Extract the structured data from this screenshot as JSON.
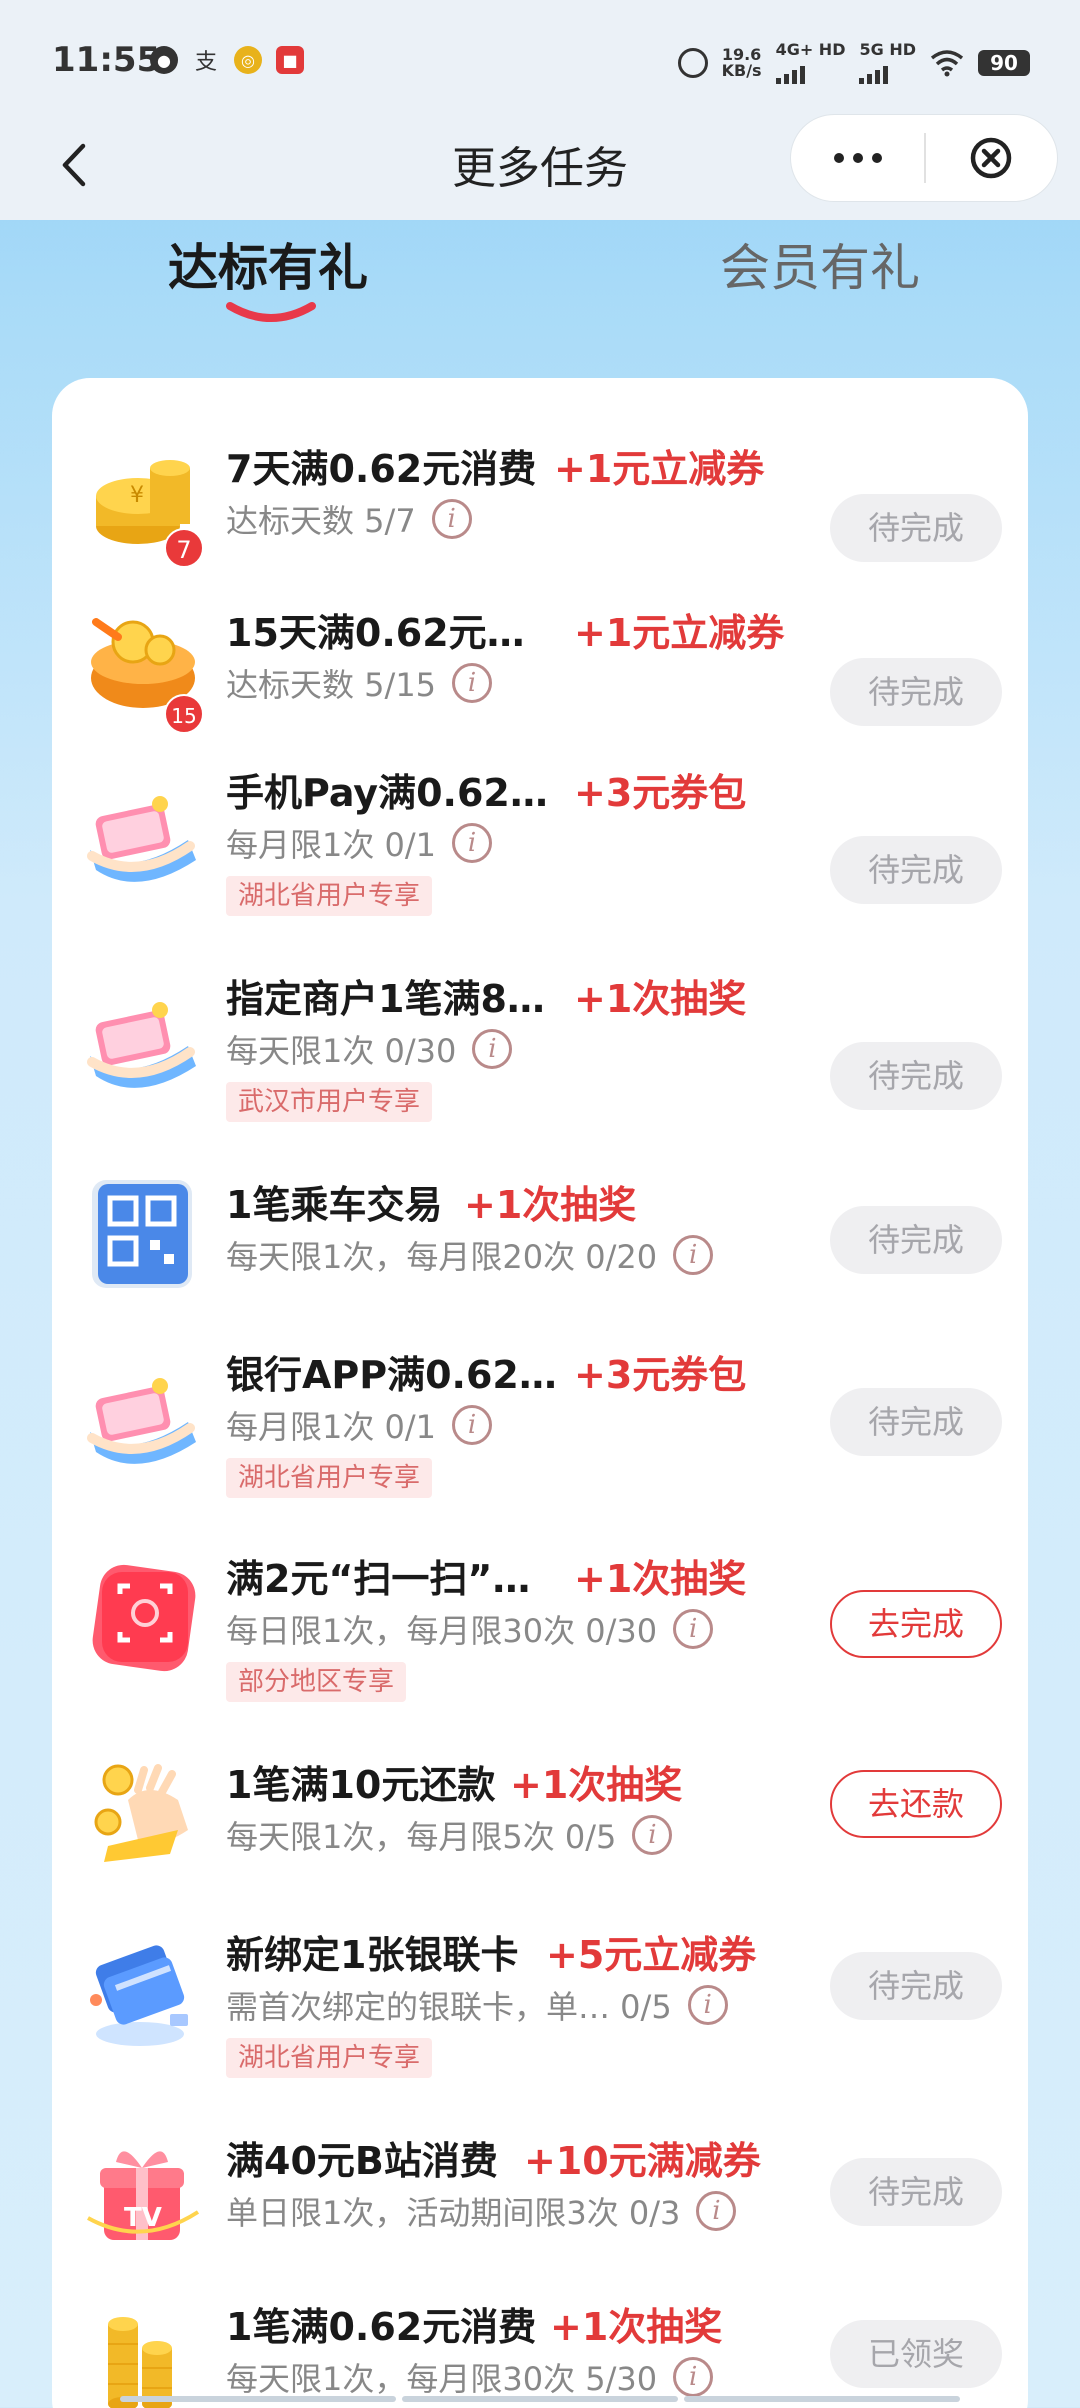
{
  "status_bar": {
    "time": "11:55",
    "net_speed": "19.6",
    "net_unit": "KB/s",
    "net1": "4G+ HD",
    "net2": "5G HD",
    "battery": "90"
  },
  "nav": {
    "title": "更多任务",
    "back_icon": "chevron-left-icon",
    "more_icon": "more-dots-icon",
    "close_icon": "close-circle-icon"
  },
  "tabs": [
    {
      "label": "达标有礼",
      "active": true
    },
    {
      "label": "会员有礼",
      "active": false
    }
  ],
  "tasks": [
    {
      "title": "7天满0.62元消费",
      "reward": "+1元立减券",
      "sub": "达标天数 5/7",
      "tag": "",
      "button": "待完成",
      "icon": "gold-coins-icon",
      "badge": "7"
    },
    {
      "title": "15天满0.62元…",
      "reward": "+1元立减券",
      "sub": "达标天数 5/15",
      "tag": "",
      "button": "待完成",
      "icon": "treasure-chest-icon",
      "badge": "15"
    },
    {
      "title": "手机Pay满0.62…",
      "reward": "+3元券包",
      "sub": "每月限1次 0/1",
      "tag": "湖北省用户专享",
      "button": "待完成",
      "icon": "hand-money-icon",
      "badge": ""
    },
    {
      "title": "指定商户1笔满8…",
      "reward": "+1次抽奖",
      "sub": "每天限1次 0/30",
      "tag": "武汉市用户专享",
      "button": "待完成",
      "icon": "hand-money-icon",
      "badge": ""
    },
    {
      "title": "1笔乘车交易",
      "reward": "+1次抽奖",
      "sub": "每天限1次，每月限20次 0/20",
      "tag": "",
      "button": "待完成",
      "icon": "qr-code-icon",
      "badge": ""
    },
    {
      "title": "银行APP满0.62…",
      "reward": "+3元券包",
      "sub": "每月限1次 0/1",
      "tag": "湖北省用户专享",
      "button": "待完成",
      "icon": "hand-money-icon",
      "badge": ""
    },
    {
      "title": "满2元“扫一扫”…",
      "reward": "+1次抽奖",
      "sub": "每日限1次，每月限30次 0/30",
      "tag": "部分地区专享",
      "button": "去完成",
      "icon": "scan-icon",
      "badge": ""
    },
    {
      "title": "1笔满10元还款",
      "reward": "+1次抽奖",
      "sub": "每天限1次，每月限5次 0/5",
      "tag": "",
      "button": "去还款",
      "icon": "hand-coin-icon",
      "badge": ""
    },
    {
      "title": "新绑定1张银联卡",
      "reward": "+5元立减券",
      "sub": "需首次绑定的银联卡，单…   0/5",
      "tag": "湖北省用户专享",
      "button": "待完成",
      "icon": "bank-card-icon",
      "badge": ""
    },
    {
      "title": "满40元B站消费",
      "reward": "+10元满减券",
      "sub": "单日限1次，活动期间限3次 0/3",
      "tag": "",
      "button": "待完成",
      "icon": "gift-box-icon",
      "badge": ""
    },
    {
      "title": "1笔满0.62元消费",
      "reward": "+1次抽奖",
      "sub": "每天限1次，每月限30次 5/30",
      "tag": "",
      "button": "已领奖",
      "icon": "coin-stack-icon",
      "badge": ""
    }
  ]
}
